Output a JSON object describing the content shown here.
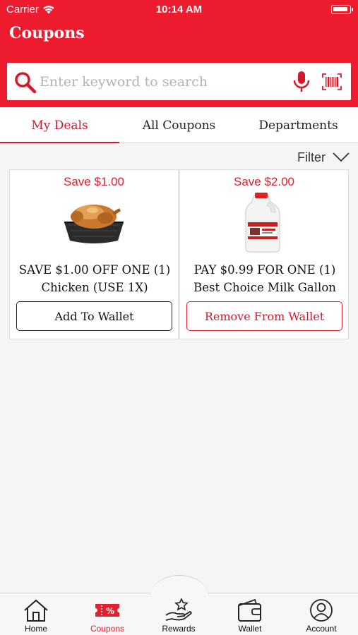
{
  "status_bar": {
    "carrier": "Carrier",
    "time": "10:14 AM"
  },
  "header": {
    "title": "Coupons",
    "background": "#ec1c2e"
  },
  "search": {
    "placeholder": "Enter keyword to search"
  },
  "tabs": [
    {
      "label": "My Deals",
      "active": true
    },
    {
      "label": "All Coupons",
      "active": false
    },
    {
      "label": "Departments",
      "active": false
    }
  ],
  "filter": {
    "label": "Filter"
  },
  "coupons": [
    {
      "save": "Save $1.00",
      "line1": "SAVE $1.00 OFF ONE (1)",
      "line2": "Chicken (USE 1X)",
      "button": "Add To Wallet",
      "image": "rotisserie-chicken"
    },
    {
      "save": "Save $2.00",
      "line1": "PAY $0.99 FOR ONE (1)",
      "line2": "Best Choice Milk Gallon",
      "button": "Remove From Wallet",
      "image": "milk-gallon"
    }
  ],
  "bottom_nav": [
    {
      "label": "Home",
      "icon": "home-icon",
      "active": false
    },
    {
      "label": "Coupons",
      "icon": "coupon-icon",
      "active": true
    },
    {
      "label": "Rewards",
      "icon": "rewards-icon",
      "active": false
    },
    {
      "label": "Wallet",
      "icon": "wallet-icon",
      "active": false
    },
    {
      "label": "Account",
      "icon": "account-icon",
      "active": false
    }
  ],
  "colors": {
    "accent": "#e2202f",
    "brand_red": "#ec1c2e"
  }
}
